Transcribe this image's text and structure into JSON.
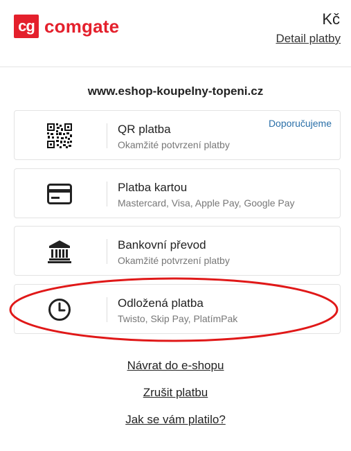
{
  "header": {
    "logo_mark": "cg",
    "logo_text": "comgate",
    "currency": "Kč",
    "detail_link": "Detail platby"
  },
  "eshop": {
    "title": "www.eshop-koupelny-topeni.cz"
  },
  "methods": [
    {
      "icon": "qr-code-icon",
      "title": "QR platba",
      "subtitle": "Okamžité potvrzení platby",
      "badge": "Doporučujeme"
    },
    {
      "icon": "credit-card-icon",
      "title": "Platba kartou",
      "subtitle": "Mastercard, Visa, Apple Pay, Google Pay"
    },
    {
      "icon": "bank-icon",
      "title": "Bankovní převod",
      "subtitle": "Okamžité potvrzení platby"
    },
    {
      "icon": "clock-icon",
      "title": "Odložená platba",
      "subtitle": "Twisto, Skip Pay, PlatímPak"
    }
  ],
  "links": {
    "back": "Návrat do e-shopu",
    "cancel": "Zrušit platbu",
    "feedback": "Jak se vám platilo?"
  },
  "colors": {
    "brand": "#e4202c",
    "badge": "#2a6fa8",
    "highlight_ellipse": "#e01818"
  }
}
